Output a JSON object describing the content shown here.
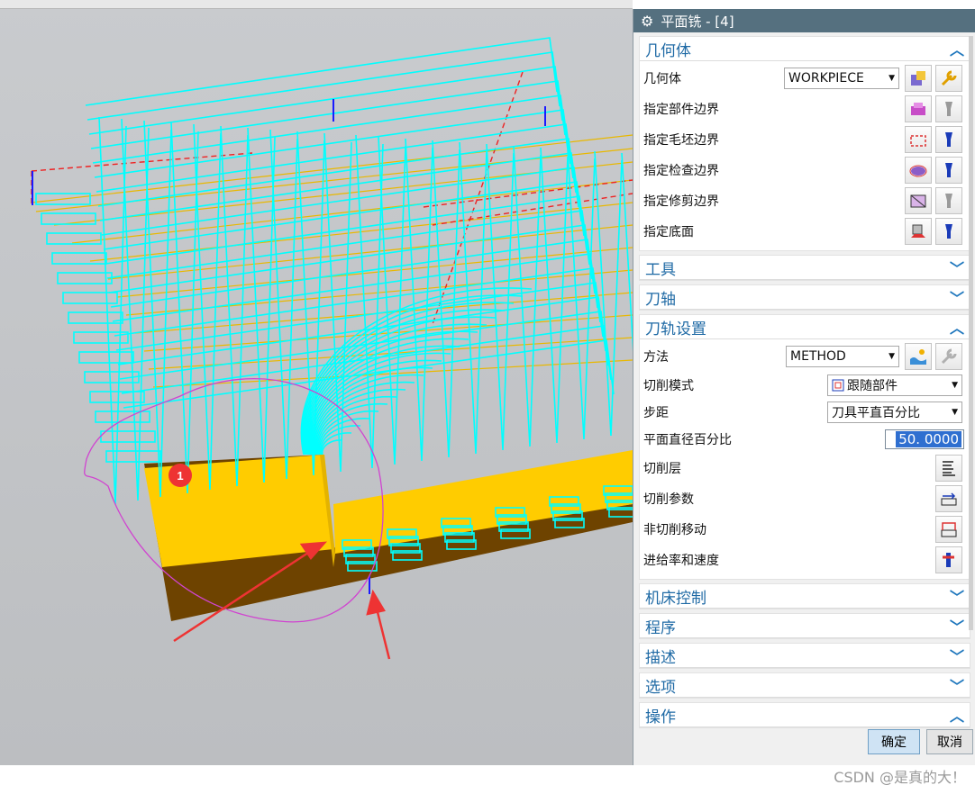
{
  "panel": {
    "title": "平面铣 - [4]",
    "sections": {
      "geometry": {
        "title": "几何体"
      },
      "tool": {
        "title": "工具"
      },
      "axis": {
        "title": "刀轴"
      },
      "path": {
        "title": "刀轨设置"
      },
      "machine": {
        "title": "机床控制"
      },
      "program": {
        "title": "程序"
      },
      "description": {
        "title": "描述"
      },
      "options": {
        "title": "选项"
      },
      "operation": {
        "title": "操作"
      }
    },
    "geometry": {
      "geometry_label": "几何体",
      "geometry_value": "WORKPIECE",
      "part_boundary": "指定部件边界",
      "blank_boundary": "指定毛坯边界",
      "check_boundary": "指定检查边界",
      "trim_boundary": "指定修剪边界",
      "floor": "指定底面"
    },
    "path": {
      "method_label": "方法",
      "method_value": "METHOD",
      "cut_pattern_label": "切削模式",
      "cut_pattern_value": "跟随部件",
      "stepover_label": "步距",
      "stepover_value": "刀具平直百分比",
      "percent_label": "平面直径百分比",
      "percent_value": "50. 0000",
      "cut_levels": "切削层",
      "cut_params": "切削参数",
      "non_cutting": "非切削移动",
      "feeds": "进给率和速度"
    },
    "ok_label": "确定",
    "cancel_label": "取消"
  },
  "viewport": {
    "marker": "1"
  },
  "watermark": "CSDN @是真的大！",
  "colors": {
    "toolpath": "#00ffff",
    "part_top": "#ffcc00",
    "part_side": "#6e4300",
    "annotation": "#ee3333",
    "circle": "#d044d0",
    "title_bar": "#55707f",
    "section_text": "#1f6aa5"
  }
}
